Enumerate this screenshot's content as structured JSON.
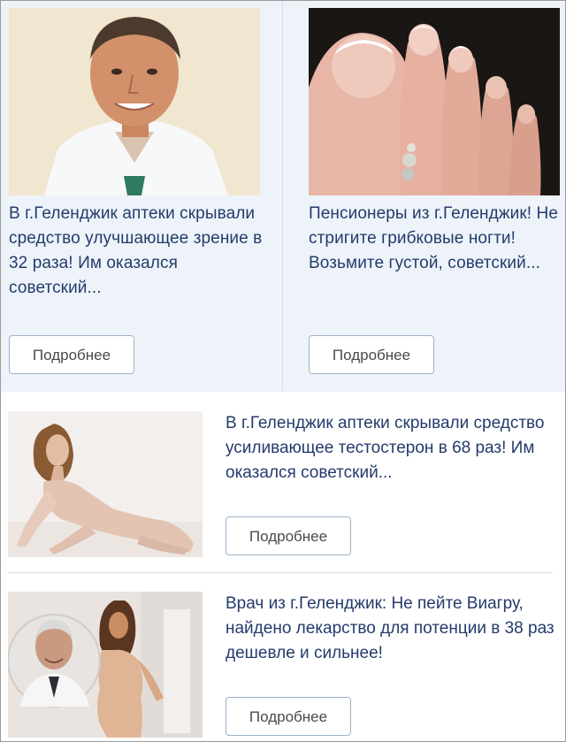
{
  "ads": [
    {
      "title": "В г.Геленджик аптеки скрывали средство улучшающее зрение в 32 раза! Им оказался советский...",
      "button_label": "Подробнее",
      "image": "doctor-portrait-photo"
    },
    {
      "title": "Пенсионеры из г.Геленджик! Не стригите грибковые ногти! Возьмите густой, советский...",
      "button_label": "Подробнее",
      "image": "toes-pedicure-photo"
    },
    {
      "title": "В г.Геленджик аптеки скрывали средство усиливающее тестостерон в 68 раз! Им оказался советский...",
      "button_label": "Подробнее",
      "image": "woman-posing-photo"
    },
    {
      "title": "Врач из г.Геленджик: Не пейте Виагру, найдено лекарство для потенции в 38 раз дешевле и сильнее!",
      "button_label": "Подробнее",
      "image": "doctor-and-woman-photo"
    }
  ],
  "colors": {
    "title_text": "#243b6b",
    "card_background": "#edf3f9",
    "button_border": "#9fb2c8"
  }
}
